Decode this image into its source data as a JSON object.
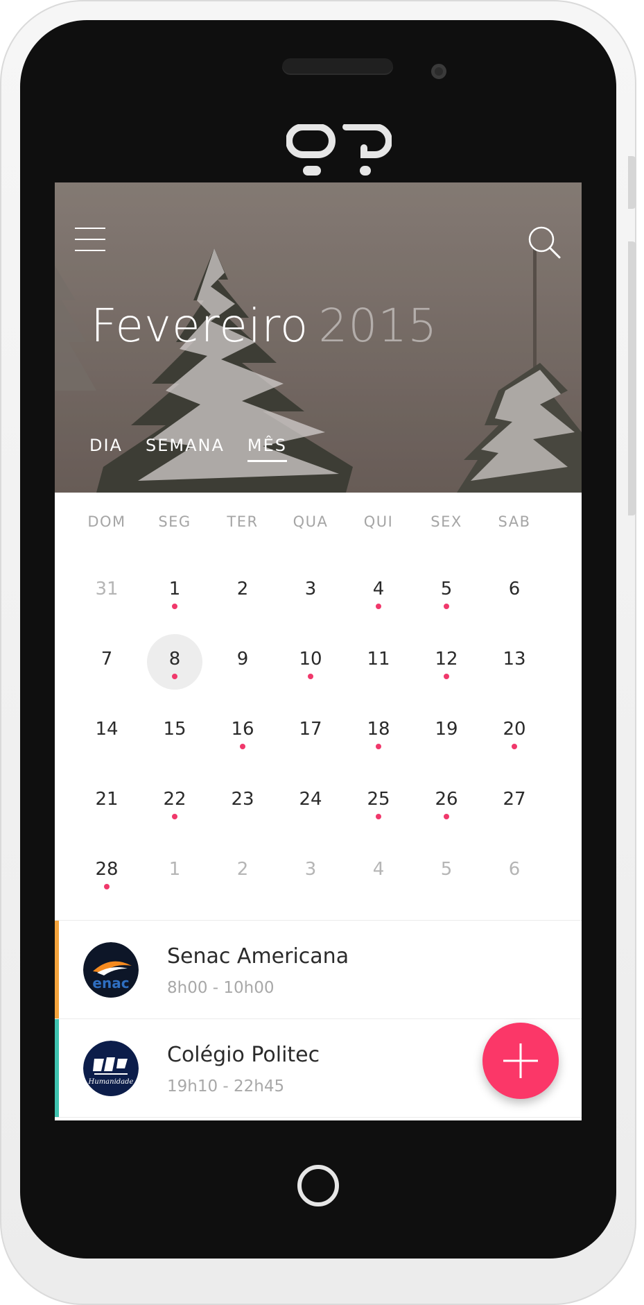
{
  "header": {
    "month": "Fevereiro",
    "year": "2015",
    "tabs": [
      {
        "label": "DIA",
        "active": false
      },
      {
        "label": "SEMANA",
        "active": false
      },
      {
        "label": "MÊS",
        "active": true
      }
    ]
  },
  "calendar": {
    "weekdays": [
      "DOM",
      "SEG",
      "TER",
      "QUA",
      "QUI",
      "SEX",
      "SAB"
    ],
    "weeks": [
      [
        {
          "day": "31",
          "muted": true
        },
        {
          "day": "1",
          "dot": true
        },
        {
          "day": "2"
        },
        {
          "day": "3"
        },
        {
          "day": "4",
          "dot": true
        },
        {
          "day": "5",
          "dot": true
        },
        {
          "day": "6"
        }
      ],
      [
        {
          "day": "7"
        },
        {
          "day": "8",
          "dot": true,
          "selected": true
        },
        {
          "day": "9"
        },
        {
          "day": "10",
          "dot": true
        },
        {
          "day": "11"
        },
        {
          "day": "12",
          "dot": true
        },
        {
          "day": "13"
        }
      ],
      [
        {
          "day": "14"
        },
        {
          "day": "15"
        },
        {
          "day": "16",
          "dot": true
        },
        {
          "day": "17"
        },
        {
          "day": "18",
          "dot": true
        },
        {
          "day": "19"
        },
        {
          "day": "20",
          "dot": true
        }
      ],
      [
        {
          "day": "21"
        },
        {
          "day": "22",
          "dot": true
        },
        {
          "day": "23"
        },
        {
          "day": "24"
        },
        {
          "day": "25",
          "dot": true
        },
        {
          "day": "26",
          "dot": true
        },
        {
          "day": "27"
        }
      ],
      [
        {
          "day": "28",
          "dot": true
        },
        {
          "day": "1",
          "muted": true
        },
        {
          "day": "2",
          "muted": true
        },
        {
          "day": "3",
          "muted": true
        },
        {
          "day": "4",
          "muted": true
        },
        {
          "day": "5",
          "muted": true
        },
        {
          "day": "6",
          "muted": true
        }
      ]
    ],
    "dot_color": "#f0386b"
  },
  "events": [
    {
      "name": "Senac Americana",
      "time": "8h00 - 10h00",
      "accent": "#f4a33c",
      "logo_icon": "senac-logo-icon"
    },
    {
      "name": "Colégio Politec",
      "time": "19h10 - 22h45",
      "accent": "#3fc3b0",
      "logo_icon": "politec-logo-icon"
    }
  ],
  "fab": {
    "icon": "plus-icon",
    "color": "#fb3768"
  }
}
